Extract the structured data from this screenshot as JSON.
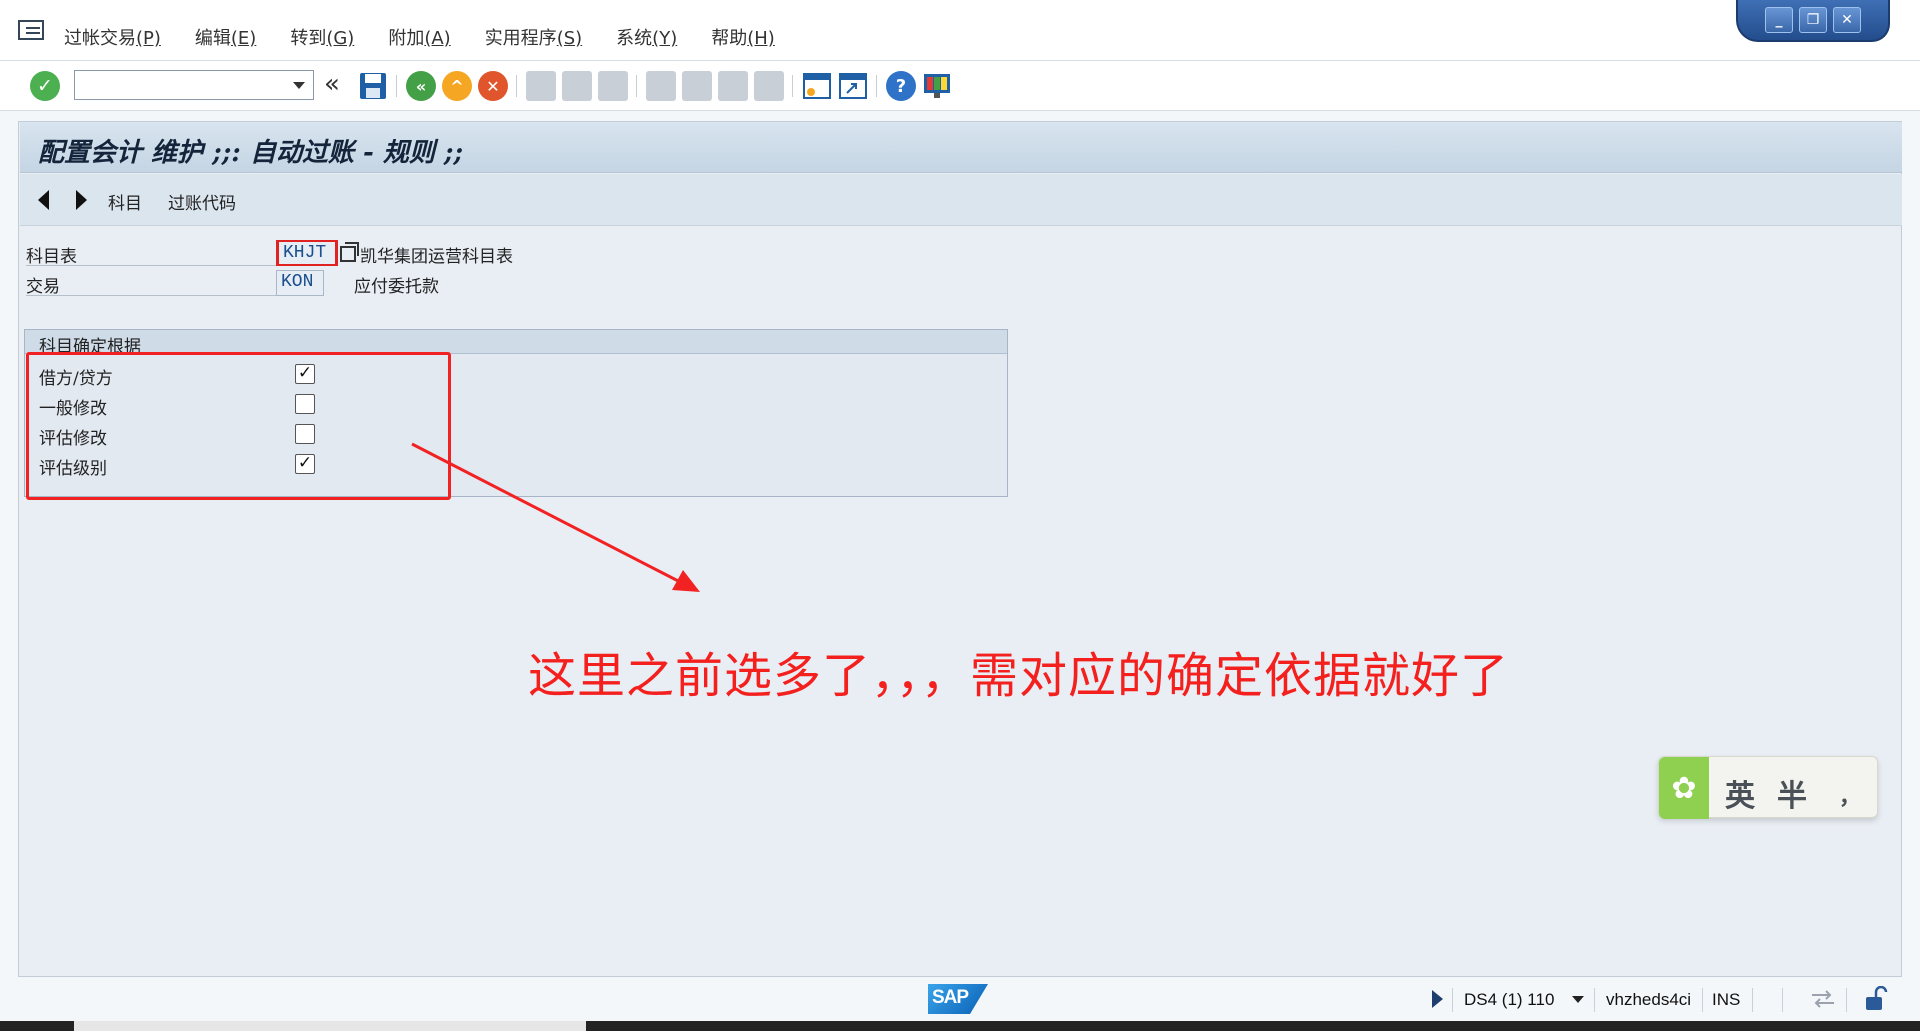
{
  "menu": {
    "items": [
      {
        "label": "过帐交易",
        "acc": "(P)"
      },
      {
        "label": "编辑",
        "acc": "(E)"
      },
      {
        "label": "转到",
        "acc": "(G)"
      },
      {
        "label": "附加",
        "acc": "(A)"
      },
      {
        "label": "实用程序",
        "acc": "(S)"
      },
      {
        "label": "系统",
        "acc": "(Y)"
      },
      {
        "label": "帮助",
        "acc": "(H)"
      }
    ]
  },
  "toolbar": {
    "command_field_value": "",
    "back_glyph": "«"
  },
  "page": {
    "title": "配置会计 维护 ;;: 自动过账 - 规则 ;;",
    "app_buttons": [
      "科目",
      "过账代码"
    ]
  },
  "fields": {
    "chart_label": "科目表",
    "chart_value": "KHJT",
    "chart_desc": "凯华集团运营科目表",
    "trans_label": "交易",
    "trans_value": "KON",
    "trans_desc": "应付委托款"
  },
  "group": {
    "title": "科目确定根据",
    "rows": [
      {
        "label": "借方/贷方",
        "checked": true
      },
      {
        "label": "一般修改",
        "checked": false
      },
      {
        "label": "评估修改",
        "checked": false
      },
      {
        "label": "评估级别",
        "checked": true
      }
    ]
  },
  "annotation": {
    "text": "这里之前选多了，，，需对应的确定依据就好了",
    "color": "#f4201e"
  },
  "ime": {
    "mode": "英",
    "width": "半",
    "punct": "，"
  },
  "status": {
    "logo": "SAP",
    "system": "DS4 (1) 110",
    "server": "vhzheds4ci",
    "mode": "INS"
  }
}
